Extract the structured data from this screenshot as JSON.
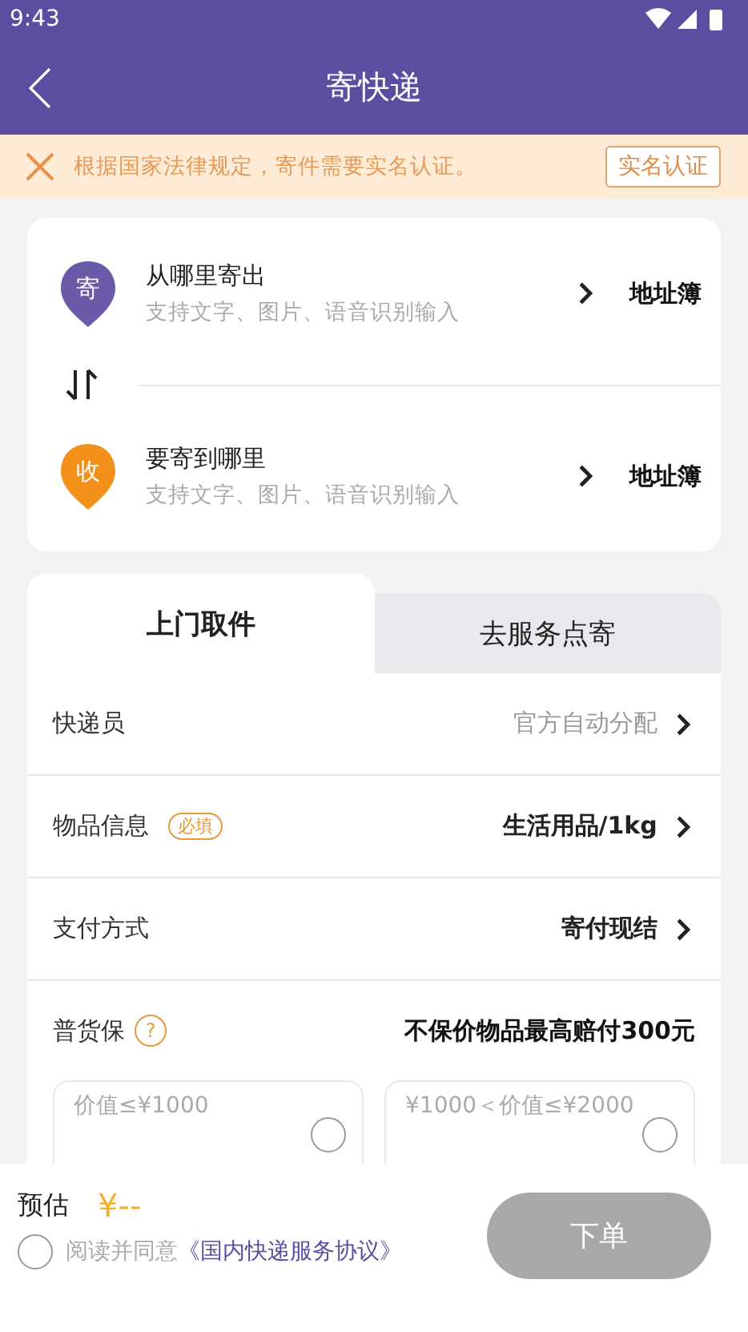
{
  "status_bar": {
    "time": "9:43"
  },
  "header": {
    "title": "寄快递"
  },
  "notice": {
    "text": "根据国家法律规定，寄件需要实名认证。",
    "action": "实名认证"
  },
  "addresses": [
    {
      "badge": "寄",
      "title": "从哪里寄出",
      "hint": "支持文字、图片、语音识别输入",
      "book": "地址簿",
      "color": "#6a5aa8"
    },
    {
      "badge": "收",
      "title": "要寄到哪里",
      "hint": "支持文字、图片、语音识别输入",
      "book": "地址簿",
      "color": "#f39019"
    }
  ],
  "tabs": [
    {
      "label": "上门取件",
      "selected": true
    },
    {
      "label": "去服务点寄",
      "selected": false
    }
  ],
  "rows": [
    {
      "label": "快递员",
      "value": "官方自动分配",
      "muted": true
    },
    {
      "label": "物品信息",
      "tag": "必填",
      "value": "生活用品/1kg",
      "muted": false
    },
    {
      "label": "支付方式",
      "value": "寄付现结",
      "muted": false
    }
  ],
  "insurance": {
    "label": "普货保",
    "help": "?",
    "summary": "不保价物品最高赔付300元",
    "options": [
      {
        "label": "价值≤¥1000",
        "selected": false
      },
      {
        "label": "¥1000＜价值≤¥2000",
        "selected": false
      }
    ]
  },
  "footer": {
    "estimate_label": "预估",
    "price": "¥--",
    "agree_checked": false,
    "agree_text": "阅读并同意",
    "agreement_link": "《国内快递服务协议》",
    "submit": "下单",
    "submit_disabled": true
  }
}
